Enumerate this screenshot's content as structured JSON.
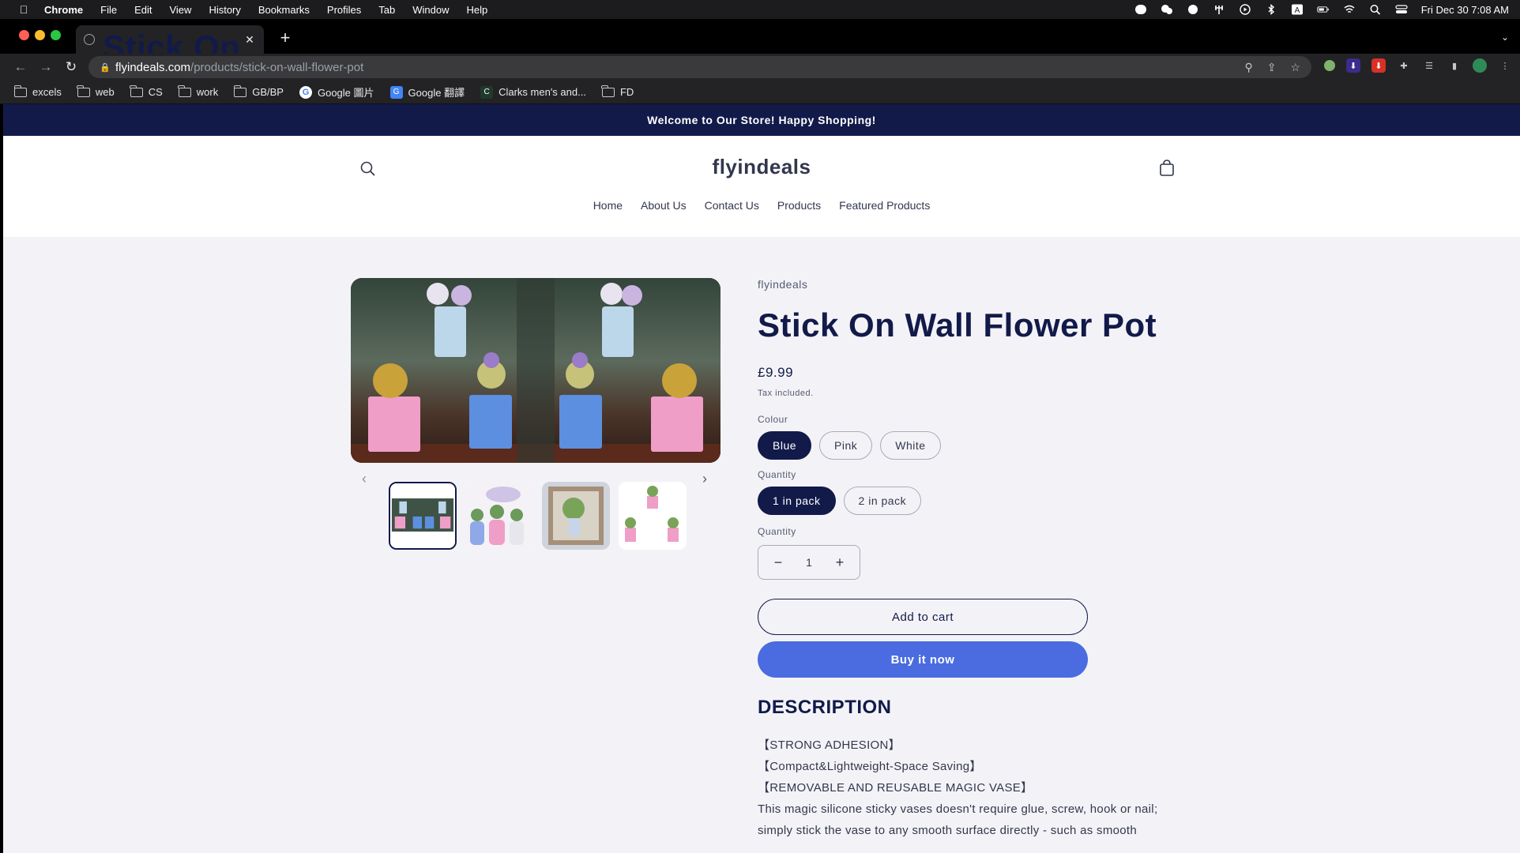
{
  "os_menubar": {
    "app": "Chrome",
    "items": [
      "File",
      "Edit",
      "View",
      "History",
      "Bookmarks",
      "Profiles",
      "Tab",
      "Window",
      "Help"
    ],
    "clock": "Fri Dec 30  7:08 AM"
  },
  "browser": {
    "tab_title": "Stick On Wall Flower Pot – flyin",
    "url_host": "flyindeals.com",
    "url_path": "/products/stick-on-wall-flower-pot",
    "bookmarks": [
      {
        "label": "excels",
        "icon": "folder-icon"
      },
      {
        "label": "web",
        "icon": "folder-icon"
      },
      {
        "label": "CS",
        "icon": "folder-icon"
      },
      {
        "label": "work",
        "icon": "folder-icon"
      },
      {
        "label": "GB/BP",
        "icon": "folder-icon"
      },
      {
        "label": "Google 圖片",
        "icon": "google-icon"
      },
      {
        "label": "Google 翻譯",
        "icon": "translate-icon"
      },
      {
        "label": "Clarks men's and...",
        "icon": "site-icon"
      },
      {
        "label": "FD",
        "icon": "folder-icon"
      }
    ]
  },
  "store": {
    "announcement": "Welcome to Our Store! Happy Shopping!",
    "logo": "flyindeals",
    "nav": [
      "Home",
      "About Us",
      "Contact Us",
      "Products",
      "Featured Products"
    ]
  },
  "product": {
    "vendor": "flyindeals",
    "title": "Stick On Wall Flower Pot",
    "price": "£9.99",
    "tax_note": "Tax included.",
    "colour_label": "Colour",
    "colours": [
      "Blue",
      "Pink",
      "White"
    ],
    "selected_colour": "Blue",
    "pack_label": "Quantity",
    "packs": [
      "1 in pack",
      "2 in pack"
    ],
    "selected_pack": "1 in pack",
    "quantity_label": "Quantity",
    "quantity": "1",
    "minus": "−",
    "plus": "+",
    "add_to_cart": "Add to cart",
    "buy_now": "Buy it now",
    "description_heading": "DESCRIPTION",
    "description_lines": [
      "【STRONG ADHESION】",
      "【Compact&Lightweight-Space Saving】",
      "【REMOVABLE AND REUSABLE MAGIC VASE】",
      "This magic silicone sticky vases doesn't require glue, screw, hook or nail;",
      "simply stick the vase to any smooth surface directly - such as smooth"
    ]
  },
  "colors": {
    "announce_bg": "#121a4a",
    "accent_navy": "#121a4a",
    "buy_button": "#4a6ce0",
    "page_bg": "#f3f3f7"
  }
}
